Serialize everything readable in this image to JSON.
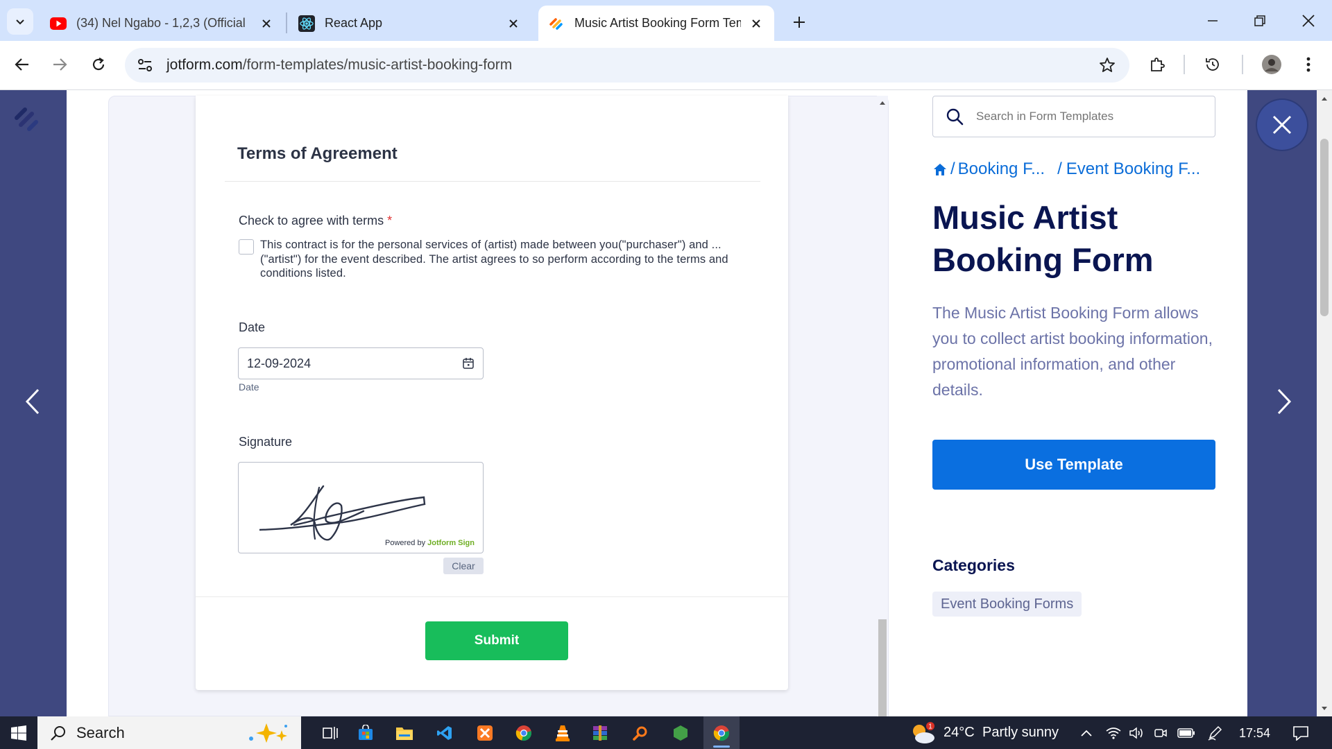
{
  "browser": {
    "tabs": [
      {
        "title": "(34) Nel Ngabo - 1,2,3 (Official",
        "favicon": "youtube-icon",
        "active": false
      },
      {
        "title": "React App",
        "favicon": "react-icon",
        "active": false
      },
      {
        "title": "Music Artist Booking Form Temp",
        "favicon": "jotform-icon",
        "active": true
      }
    ],
    "url_host": "jotform.com",
    "url_path": "/form-templates/music-artist-booking-form"
  },
  "form": {
    "section_title": "Terms of Agreement",
    "terms_label": "Check to agree with terms",
    "required_mark": "*",
    "terms_text": "This contract is for the personal services of (artist) made between you(\"purchaser\") and ... (\"artist\") for the event described. The artist agrees to so perform according to the terms and conditions listed.",
    "terms_checked": false,
    "date_label": "Date",
    "date_value": "12-09-2024",
    "date_sublabel": "Date",
    "signature_label": "Signature",
    "signature_powered_prefix": "Powered by",
    "signature_powered_brand": "Jotform Sign",
    "clear_label": "Clear",
    "submit_label": "Submit"
  },
  "panel": {
    "search_placeholder": "Search in Form Templates",
    "breadcrumb": [
      "Booking F...",
      "Event Booking F..."
    ],
    "title": "Music Artist Booking Form",
    "description": "The Music Artist Booking Form allows you to collect artist booking information, promotional information, and other details.",
    "use_template_label": "Use Template",
    "categories_title": "Categories",
    "categories": [
      "Event Booking Forms"
    ]
  },
  "taskbar": {
    "search_label": "Search",
    "weather_temp": "24°C",
    "weather_desc": "Partly sunny",
    "weather_badge": "1",
    "time": "17:54"
  },
  "colors": {
    "brand_blue": "#0a6fe0",
    "submit_green": "#18bd5b",
    "title_navy": "#0a1551",
    "overlay": "#3f4880"
  }
}
